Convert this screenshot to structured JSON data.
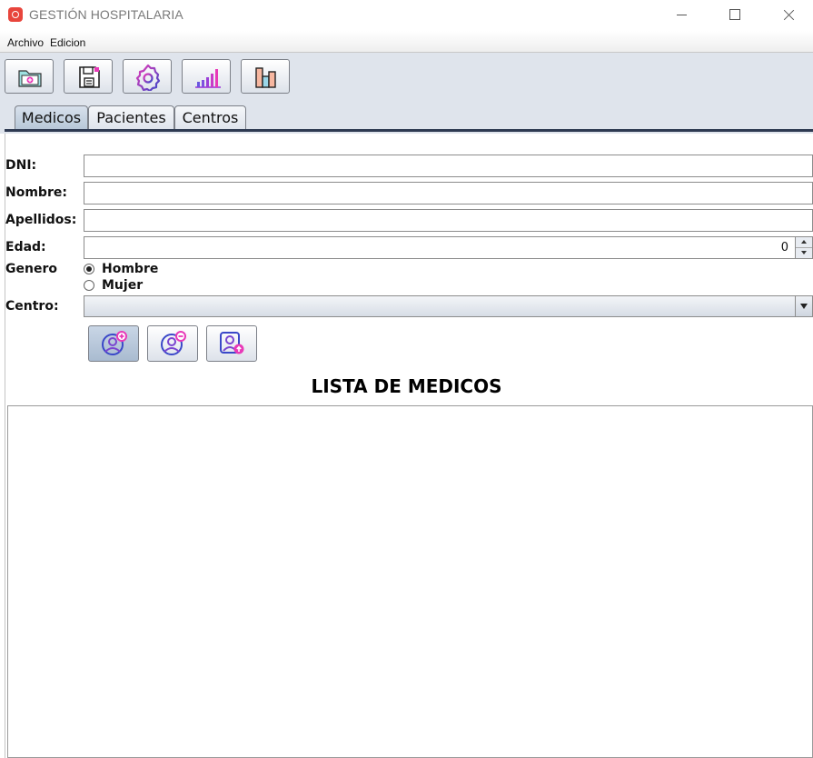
{
  "window": {
    "title": "GESTIÓN HOSPITALARIA",
    "icon": "hospital-app-icon"
  },
  "menu": {
    "items": [
      "Archivo",
      "Edicion"
    ]
  },
  "toolbar": {
    "buttons": [
      {
        "icon": "folder-medical-icon"
      },
      {
        "icon": "save-floppy-icon"
      },
      {
        "icon": "settings-gear-icon"
      },
      {
        "icon": "bar-chart-icon"
      },
      {
        "icon": "column-chart-icon"
      }
    ]
  },
  "tabs": [
    {
      "label": "Medicos",
      "active": true
    },
    {
      "label": "Pacientes",
      "active": false
    },
    {
      "label": "Centros",
      "active": false
    }
  ],
  "form": {
    "dni_label": "DNI:",
    "dni_value": "",
    "nombre_label": "Nombre:",
    "nombre_value": "",
    "apellidos_label": "Apellidos:",
    "apellidos_value": "",
    "edad_label": "Edad:",
    "edad_value": "0",
    "genero_label": "Genero",
    "genero_options": [
      "Hombre",
      "Mujer"
    ],
    "genero_selected": "Hombre",
    "centro_label": "Centro:",
    "centro_value": ""
  },
  "actions": [
    {
      "icon": "add-user-icon"
    },
    {
      "icon": "remove-user-icon"
    },
    {
      "icon": "update-user-icon"
    }
  ],
  "list": {
    "title": "LISTA DE MEDICOS",
    "items": []
  },
  "colors": {
    "accent_purple": "#9b2fd6",
    "accent_pink": "#e83ab8",
    "accent_blue": "#3a48c8",
    "toolbar_bg": "#dfe4ec",
    "tab_underline": "#2e3a52"
  }
}
